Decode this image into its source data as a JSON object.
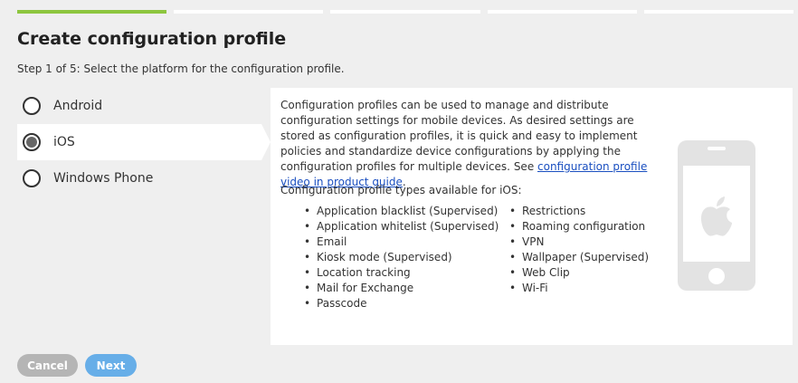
{
  "progress": {
    "total_steps": 5,
    "current_step": 1
  },
  "header": {
    "title": "Create configuration profile",
    "step_text": "Step 1 of 5: Select the platform for the configuration profile."
  },
  "platforms": [
    {
      "label": "Android",
      "selected": false
    },
    {
      "label": "iOS",
      "selected": true
    },
    {
      "label": "Windows Phone",
      "selected": false
    }
  ],
  "panel": {
    "description": "Configuration profiles can be used to manage and distribute configuration settings for mobile devices. As desired settings are stored as configuration profiles, it is quick and easy to implement policies and standardize device configurations by applying the configuration profiles for multiple devices. See ",
    "link_text": "configuration profile video in product guide",
    "link_suffix": ".",
    "types_heading": "Configuration profile types available for iOS:",
    "types_col1": [
      "Application blacklist (Supervised)",
      "Application whitelist (Supervised)",
      "Email",
      "Kiosk mode (Supervised)",
      "Location tracking",
      "Mail for Exchange",
      "Passcode"
    ],
    "types_col2": [
      "Restrictions",
      "Roaming configuration",
      "VPN",
      "Wallpaper (Supervised)",
      "Web Clip",
      "Wi-Fi"
    ],
    "illustration_icon": "iphone-apple-icon"
  },
  "buttons": {
    "cancel": "Cancel",
    "next": "Next"
  },
  "colors": {
    "progress_active": "#8dc63f",
    "next_button": "#67aee8",
    "cancel_button": "#b5b5b5",
    "link": "#1a4fc0"
  }
}
